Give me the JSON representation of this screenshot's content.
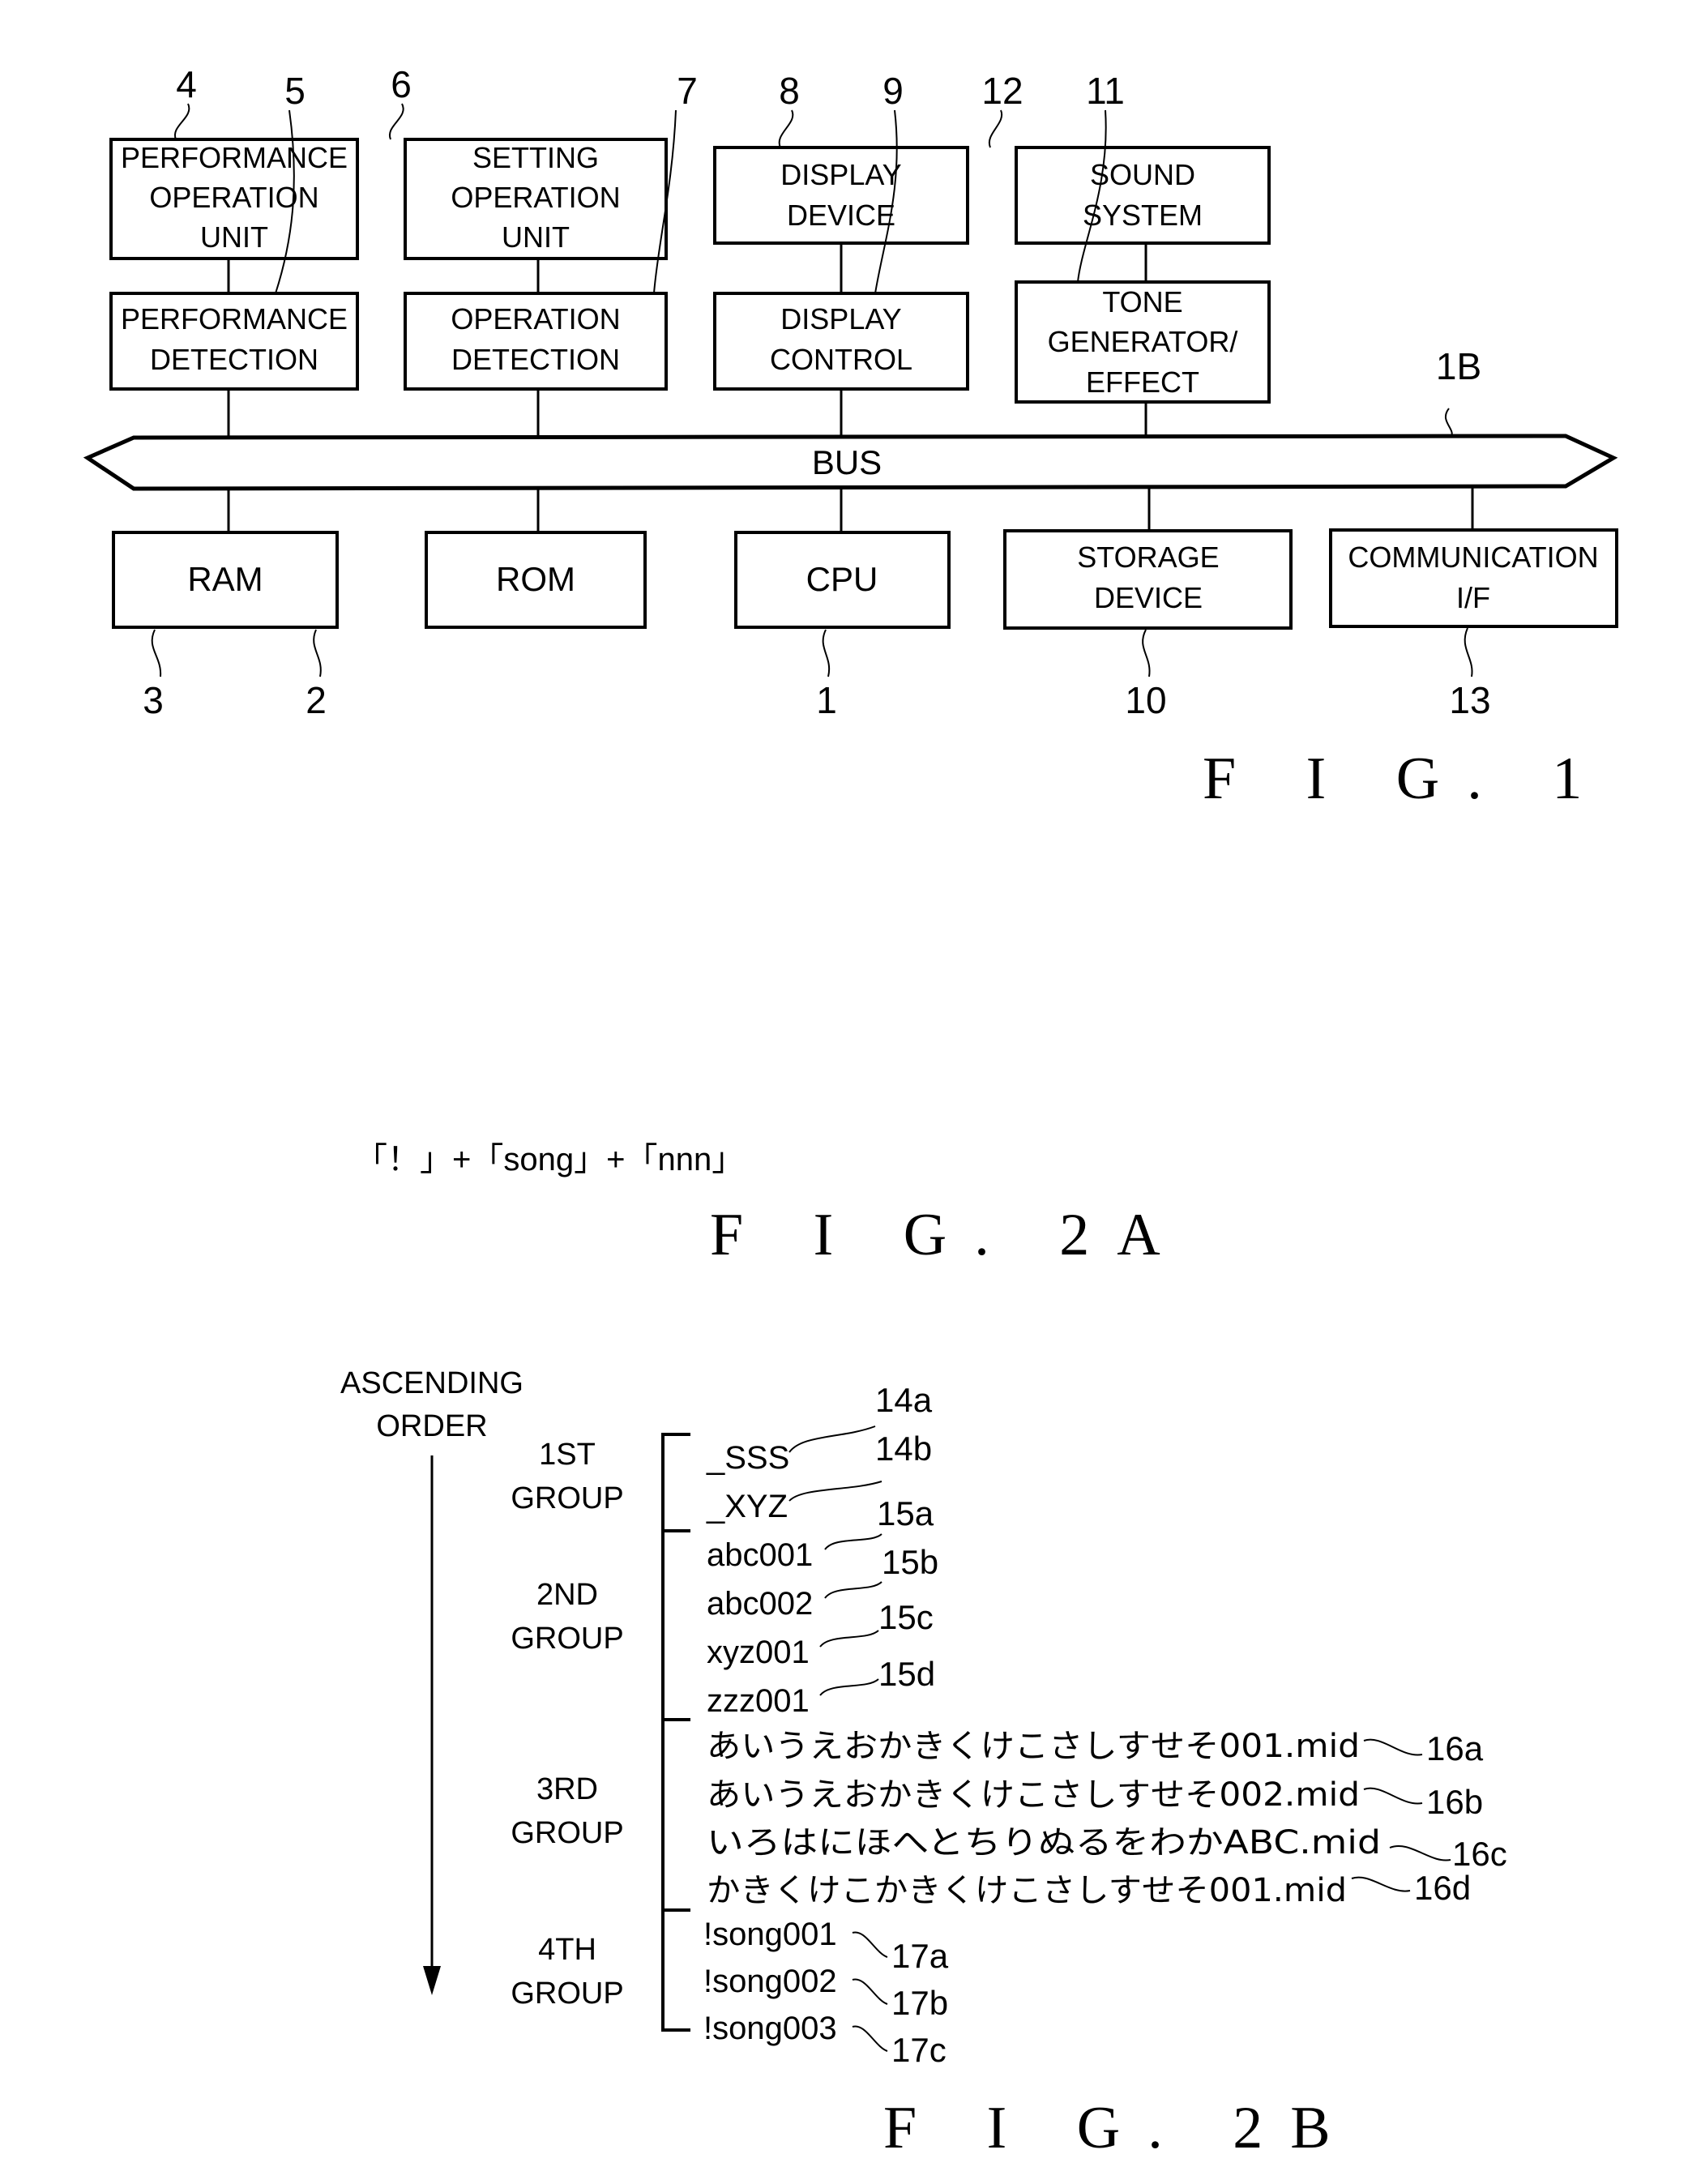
{
  "fig1": {
    "caption": "F I G. 1",
    "blocks": [
      {
        "id": "performance_operation_unit",
        "ref": "4",
        "lines": [
          "PERFORMANCE",
          "OPERATION",
          "UNIT"
        ]
      },
      {
        "id": "performance_detection",
        "ref": "5",
        "lines": [
          "PERFORMANCE",
          "DETECTION"
        ]
      },
      {
        "id": "setting_operation_unit",
        "ref": "6",
        "lines": [
          "SETTING",
          "OPERATION",
          "UNIT"
        ]
      },
      {
        "id": "operation_detection",
        "ref": "7",
        "lines": [
          "OPERATION",
          "DETECTION"
        ]
      },
      {
        "id": "display_device",
        "ref": "8",
        "lines": [
          "DISPLAY",
          "DEVICE"
        ]
      },
      {
        "id": "display_control",
        "ref": "9",
        "lines": [
          "DISPLAY",
          "CONTROL"
        ]
      },
      {
        "id": "sound_system",
        "ref": "12",
        "lines": [
          "SOUND",
          "SYSTEM"
        ]
      },
      {
        "id": "tone_generator_effect",
        "ref": "11",
        "lines": [
          "TONE",
          "GENERATOR/",
          "EFFECT"
        ]
      },
      {
        "id": "ram",
        "ref": "3",
        "lines": [
          "RAM"
        ]
      },
      {
        "id": "rom",
        "ref": "2",
        "lines": [
          "ROM"
        ]
      },
      {
        "id": "cpu",
        "ref": "1",
        "lines": [
          "CPU"
        ]
      },
      {
        "id": "storage_device",
        "ref": "10",
        "lines": [
          "STORAGE",
          "DEVICE"
        ]
      },
      {
        "id": "communication_if",
        "ref": "13",
        "lines": [
          "COMMUNICATION",
          "I/F"
        ]
      }
    ],
    "bus": {
      "label": "BUS",
      "ref": "1B"
    }
  },
  "fig2a": {
    "formula": "「！」+「song」+「nnn」",
    "caption": "F I G. 2A"
  },
  "fig2b": {
    "caption": "F I G. 2B",
    "order_label": [
      "ASCENDING",
      "ORDER"
    ],
    "groups": [
      {
        "label": [
          "1ST",
          "GROUP"
        ],
        "entries": [
          {
            "name": "_SSS",
            "ref": "14a"
          },
          {
            "name": "_XYZ",
            "ref": "14b"
          }
        ]
      },
      {
        "label": [
          "2ND",
          "GROUP"
        ],
        "entries": [
          {
            "name": "abc001",
            "ref": "15a"
          },
          {
            "name": "abc002",
            "ref": "15b"
          },
          {
            "name": "xyz001",
            "ref": "15c"
          },
          {
            "name": "zzz001",
            "ref": "15d"
          }
        ]
      },
      {
        "label": [
          "3RD",
          "GROUP"
        ],
        "entries": [
          {
            "name": "あいうえおかきくけこさしすせそ001.mid",
            "ref": "16a"
          },
          {
            "name": "あいうえおかきくけこさしすせそ002.mid",
            "ref": "16b"
          },
          {
            "name": "いろはにほへとちりぬるをわかABC.mid",
            "ref": "16c"
          },
          {
            "name": "かきくけこかきくけこさしすせそ001.mid",
            "ref": "16d"
          }
        ]
      },
      {
        "label": [
          "4TH",
          "GROUP"
        ],
        "entries": [
          {
            "name": "!song001",
            "ref": "17a"
          },
          {
            "name": "!song002",
            "ref": "17b"
          },
          {
            "name": "!song003",
            "ref": "17c"
          }
        ]
      }
    ]
  }
}
